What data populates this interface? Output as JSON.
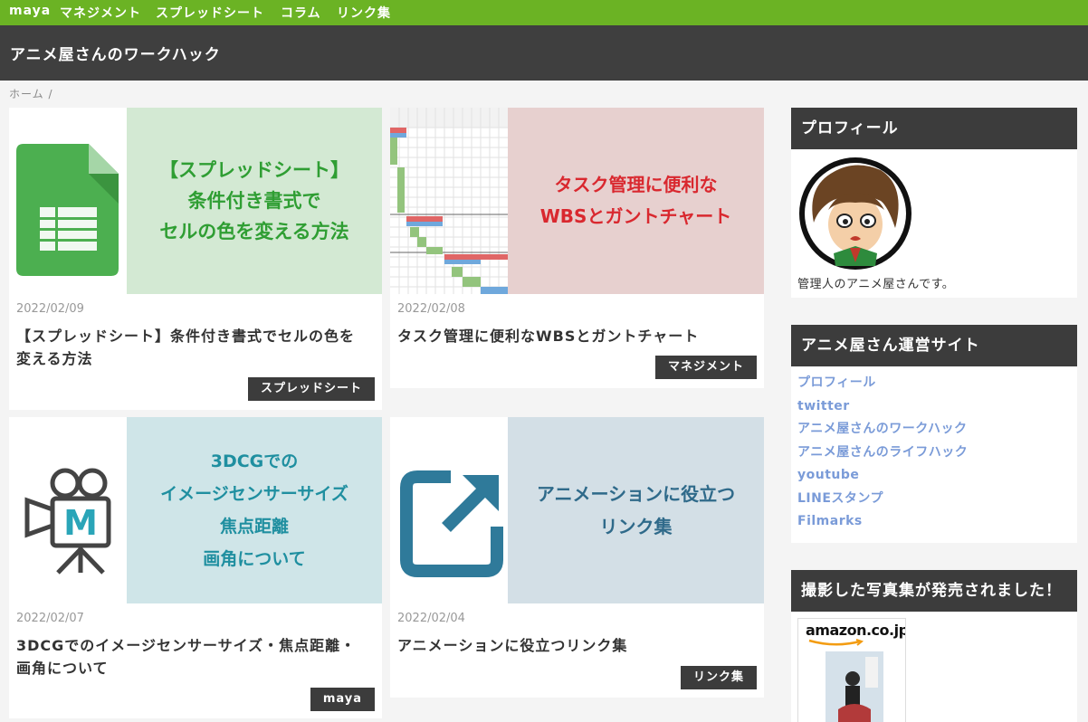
{
  "topnav": {
    "items": [
      "maya",
      "マネジメント",
      "スプレッドシート",
      "コラム",
      "リンク集"
    ]
  },
  "header": {
    "title": "アニメ屋さんのワークハック"
  },
  "breadcrumb": {
    "home": "ホーム",
    "separator": "/"
  },
  "posts": [
    {
      "date": "2022/02/09",
      "title_lines": [
        "【スプレッドシート】条件付き書式でセルの色を",
        "変える方法"
      ],
      "category": "スプレッドシート",
      "thumb_lines": [
        "【スプレッドシート】",
        "条件付き書式で",
        "セルの色を変える方法"
      ],
      "thumb_bg": "#d3e9d3",
      "thumb_text_color": "#2f9e33",
      "icon": "google-sheets-icon"
    },
    {
      "date": "2022/02/08",
      "title_lines": [
        "タスク管理に便利なWBSとガントチャート"
      ],
      "category": "マネジメント",
      "thumb_lines": [
        "タスク管理に便利な",
        "WBSとガントチャート"
      ],
      "thumb_bg": "#e7d0cf",
      "thumb_text_color": "#d9282f",
      "icon": "gantt-chart-icon"
    },
    {
      "date": "2022/02/07",
      "title_lines": [
        "3DCGでのイメージセンサーサイズ・焦点距離・",
        "画角について"
      ],
      "category": "maya",
      "thumb_lines": [
        "3DCGでの",
        "イメージセンサーサイズ",
        "焦点距離",
        "画角について"
      ],
      "thumb_bg": "#cfe5e8",
      "thumb_text_color": "#1f8fa0",
      "icon": "maya-camera-icon"
    },
    {
      "date": "2022/02/04",
      "title_lines": [
        "アニメーションに役立つリンク集"
      ],
      "category": "リンク集",
      "thumb_lines": [
        "アニメーションに役立つ",
        "リンク集"
      ],
      "thumb_bg": "#d3dfe6",
      "thumb_text_color": "#2f6a8a",
      "icon": "external-link-icon"
    }
  ],
  "sidebar": {
    "profile": {
      "heading": "プロフィール",
      "text": "管理人のアニメ屋さんです。"
    },
    "sites": {
      "heading": "アニメ屋さん運営サイト",
      "links": [
        "プロフィール",
        "twitter",
        "アニメ屋さんのワークハック",
        "アニメ屋さんのライフハック",
        "youtube",
        "LINEスタンプ",
        "Filmarks"
      ]
    },
    "photobook": {
      "heading": "撮影した写真集が発売されました！",
      "logo": "amazon.co.jp"
    }
  },
  "colors": {
    "nav_green": "#6bb324",
    "header_dark": "#3f3f3f",
    "link_blue": "#7a9bd8"
  }
}
